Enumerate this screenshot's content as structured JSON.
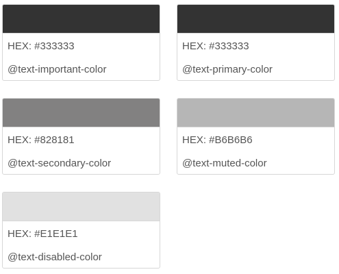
{
  "swatches": [
    {
      "color": "#333333",
      "hex_label": "HEX: #333333",
      "variable": "@text-important-color"
    },
    {
      "color": "#333333",
      "hex_label": "HEX: #333333",
      "variable": "@text-primary-color"
    },
    {
      "color": "#828181",
      "hex_label": "HEX: #828181",
      "variable": "@text-secondary-color"
    },
    {
      "color": "#B6B6B6",
      "hex_label": "HEX: #B6B6B6",
      "variable": "@text-muted-color"
    },
    {
      "color": "#E1E1E1",
      "hex_label": "HEX: #E1E1E1",
      "variable": "@text-disabled-color"
    }
  ]
}
